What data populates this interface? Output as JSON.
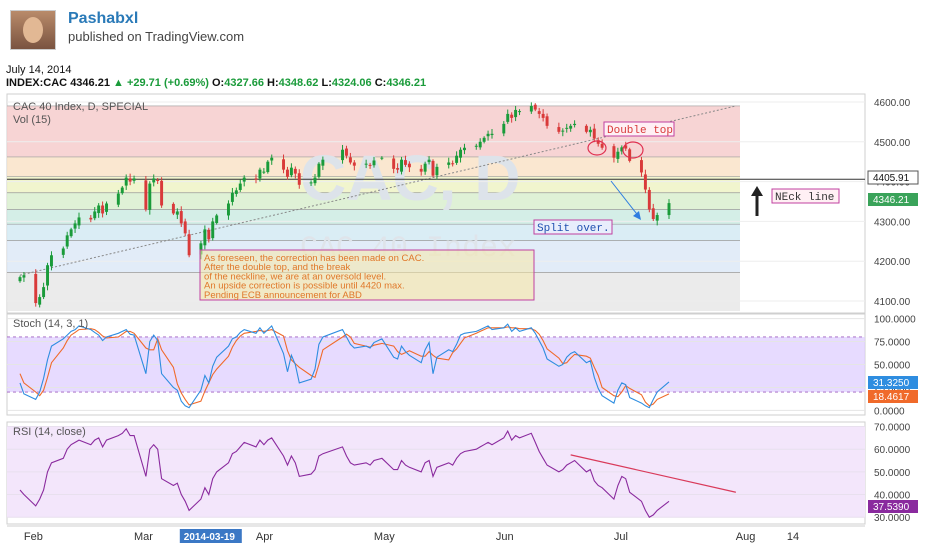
{
  "header": {
    "author": "Pashabxl",
    "published": "published on TradingView.com"
  },
  "date": "July 14, 2014",
  "ohlc": {
    "symbol": "INDEX:CAC",
    "last": "4346.21",
    "change": "+29.71 (+0.69%)",
    "o_label": "O:",
    "o": "4327.66",
    "h_label": "H:",
    "h": "4348.62",
    "l_label": "L:",
    "l": "4324.06",
    "c_label": "C:",
    "c": "4346.21"
  },
  "main_pane": {
    "title": "CAC 40 Index, D, SPECIAL",
    "vol_label": "Vol (15)",
    "watermark": "CAC, D",
    "watermark_sub": "CAC 40 Index",
    "neckline_level": "4405.91",
    "last_price": "4346.21",
    "annotations": {
      "double_top": "Double top",
      "neck_line": "NEck line",
      "split_over": "Split over.",
      "comment": [
        "As foreseen, the correction has been made on CAC.",
        "After the double top, and the break",
        "of the neckline, we are at an oversold level.",
        "An upside correction is possible until 4420 max.",
        "Pending ECB announcement for ABD"
      ]
    }
  },
  "stoch_pane": {
    "title": "Stoch (14, 3, 1)",
    "k_value": "31.3250",
    "d_value": "18.4617"
  },
  "rsi_pane": {
    "title": "RSI (14, close)",
    "value": "37.5390"
  },
  "x_axis": {
    "labels": [
      "Feb",
      "Mar",
      "2014-03-19",
      "Apr",
      "May",
      "Jun",
      "Jul",
      "Aug",
      "14"
    ]
  },
  "colors": {
    "up": "#1a9b3a",
    "down": "#d93a3a",
    "stoch_k": "#2e8de0",
    "stoch_d": "#f06a2a",
    "rsi": "#8a2a9e",
    "trendline": "#d93a5a"
  },
  "chart_data": [
    {
      "type": "candlestick",
      "title": "CAC 40 Index, D, SPECIAL",
      "y_ticks": [
        "4600.00",
        "4500.00",
        "4400.00",
        "4300.00",
        "4200.00",
        "4100.00"
      ],
      "ylim": [
        4070,
        4620
      ],
      "fib_levels": [
        4590,
        4462,
        4413,
        4372,
        4330,
        4293,
        4252,
        4172
      ],
      "x": [
        "2014-01-30",
        "2014-01-31",
        "2014-02-03",
        "2014-02-04",
        "2014-02-05",
        "2014-02-06",
        "2014-02-07",
        "2014-02-10",
        "2014-02-11",
        "2014-02-12",
        "2014-02-13",
        "2014-02-14",
        "2014-02-17",
        "2014-02-18",
        "2014-02-19",
        "2014-02-20",
        "2014-02-21",
        "2014-02-24",
        "2014-02-25",
        "2014-02-26",
        "2014-02-27",
        "2014-02-28",
        "2014-03-03",
        "2014-03-04",
        "2014-03-05",
        "2014-03-06",
        "2014-03-07",
        "2014-03-10",
        "2014-03-11",
        "2014-03-12",
        "2014-03-13",
        "2014-03-14",
        "2014-03-17",
        "2014-03-18",
        "2014-03-19",
        "2014-03-20",
        "2014-03-21",
        "2014-03-24",
        "2014-03-25",
        "2014-03-26",
        "2014-03-27",
        "2014-03-28",
        "2014-03-31",
        "2014-04-01",
        "2014-04-02",
        "2014-04-03",
        "2014-04-04",
        "2014-04-07",
        "2014-04-08",
        "2014-04-09",
        "2014-04-10",
        "2014-04-11",
        "2014-04-14",
        "2014-04-15",
        "2014-04-16",
        "2014-04-17",
        "2014-04-22",
        "2014-04-23",
        "2014-04-24",
        "2014-04-25",
        "2014-04-28",
        "2014-04-29",
        "2014-04-30",
        "2014-05-02",
        "2014-05-05",
        "2014-05-06",
        "2014-05-07",
        "2014-05-08",
        "2014-05-09",
        "2014-05-12",
        "2014-05-13",
        "2014-05-14",
        "2014-05-15",
        "2014-05-16",
        "2014-05-19",
        "2014-05-20",
        "2014-05-21",
        "2014-05-22",
        "2014-05-23",
        "2014-05-26",
        "2014-05-27",
        "2014-05-28",
        "2014-05-29",
        "2014-05-30",
        "2014-06-02",
        "2014-06-03",
        "2014-06-04",
        "2014-06-05",
        "2014-06-06",
        "2014-06-09",
        "2014-06-10",
        "2014-06-11",
        "2014-06-12",
        "2014-06-13",
        "2014-06-16",
        "2014-06-17",
        "2014-06-18",
        "2014-06-19",
        "2014-06-20",
        "2014-06-23",
        "2014-06-24",
        "2014-06-25",
        "2014-06-26",
        "2014-06-27",
        "2014-06-30",
        "2014-07-01",
        "2014-07-02",
        "2014-07-03",
        "2014-07-04",
        "2014-07-07",
        "2014-07-08",
        "2014-07-09",
        "2014-07-10",
        "2014-07-11",
        "2014-07-14"
      ],
      "close": [
        4160,
        4165,
        4095,
        4110,
        4135,
        4190,
        4215,
        4232,
        4265,
        4280,
        4295,
        4310,
        4305,
        4325,
        4340,
        4320,
        4345,
        4370,
        4385,
        4410,
        4400,
        4408,
        4330,
        4395,
        4408,
        4402,
        4340,
        4320,
        4325,
        4295,
        4270,
        4215,
        4245,
        4280,
        4255,
        4300,
        4315,
        4345,
        4372,
        4378,
        4395,
        4410,
        4406,
        4430,
        4425,
        4450,
        4460,
        4430,
        4412,
        4435,
        4420,
        4392,
        4398,
        4410,
        4445,
        4455,
        4480,
        4465,
        4448,
        4440,
        4445,
        4440,
        4453,
        4460,
        4432,
        4430,
        4455,
        4442,
        4436,
        4425,
        4445,
        4455,
        4415,
        4437,
        4448,
        4445,
        4465,
        4480,
        4485,
        4490,
        4500,
        4510,
        4520,
        4520,
        4545,
        4570,
        4560,
        4580,
        4577,
        4590,
        4581,
        4570,
        4560,
        4540,
        4525,
        4528,
        4535,
        4540,
        4545,
        4525,
        4530,
        4508,
        4495,
        4485,
        4460,
        4475,
        4486,
        4483,
        4452,
        4423,
        4380,
        4330,
        4306,
        4316,
        4346
      ],
      "trendlines": [
        {
          "from": [
            "2014-01-30",
            4165
          ],
          "to": [
            "2014-07-31",
            4590
          ]
        },
        {
          "from": [
            "2014-06-20",
            4410
          ],
          "to": [
            "2014-07-31",
            4410
          ]
        }
      ]
    },
    {
      "type": "line",
      "title": "Stoch (14, 3, 1)",
      "y_ticks": [
        "100.0000",
        "75.0000",
        "50.0000",
        "25.0000",
        "0.0000"
      ],
      "ylim": [
        -5,
        105
      ],
      "bands": [
        20,
        80
      ],
      "series": [
        {
          "name": "K",
          "values": [
            30,
            18,
            12,
            20,
            35,
            55,
            70,
            78,
            82,
            86,
            88,
            92,
            88,
            85,
            82,
            76,
            80,
            84,
            86,
            88,
            83,
            82,
            40,
            75,
            82,
            76,
            40,
            25,
            22,
            10,
            5,
            3,
            22,
            38,
            30,
            48,
            58,
            70,
            78,
            80,
            85,
            88,
            84,
            90,
            84,
            88,
            92,
            62,
            42,
            60,
            50,
            30,
            34,
            45,
            72,
            80,
            88,
            80,
            72,
            68,
            70,
            68,
            74,
            78,
            58,
            56,
            70,
            64,
            60,
            52,
            66,
            74,
            40,
            58,
            66,
            64,
            72,
            82,
            84,
            86,
            88,
            90,
            92,
            88,
            90,
            94,
            86,
            90,
            86,
            90,
            84,
            76,
            68,
            56,
            48,
            50,
            58,
            62,
            64,
            52,
            54,
            36,
            24,
            16,
            8,
            22,
            30,
            28,
            14,
            8,
            5,
            3,
            12,
            20,
            31
          ]
        },
        {
          "name": "D",
          "values": [
            40,
            30,
            20,
            16,
            22,
            36,
            52,
            68,
            76,
            82,
            85,
            88,
            89,
            88,
            85,
            81,
            79,
            80,
            83,
            86,
            86,
            84,
            68,
            66,
            66,
            78,
            66,
            47,
            29,
            19,
            12,
            6,
            10,
            21,
            30,
            39,
            45,
            59,
            69,
            76,
            81,
            84,
            86,
            87,
            86,
            87,
            88,
            81,
            65,
            55,
            51,
            47,
            38,
            36,
            50,
            66,
            80,
            83,
            80,
            73,
            70,
            69,
            71,
            73,
            70,
            64,
            61,
            63,
            65,
            59,
            59,
            64,
            60,
            57,
            55,
            63,
            67,
            73,
            79,
            84,
            86,
            88,
            90,
            90,
            90,
            91,
            90,
            90,
            89,
            89,
            87,
            83,
            76,
            67,
            57,
            51,
            52,
            57,
            61,
            59,
            57,
            47,
            38,
            25,
            16,
            15,
            20,
            27,
            24,
            17,
            9,
            5,
            7,
            12,
            18
          ]
        }
      ]
    },
    {
      "type": "line",
      "title": "RSI (14, close)",
      "y_ticks": [
        "70.0000",
        "60.0000",
        "50.0000",
        "40.0000",
        "30.0000"
      ],
      "ylim": [
        27,
        72
      ],
      "bands": [
        30,
        70
      ],
      "series": [
        {
          "name": "RSI",
          "values": [
            42,
            40,
            35,
            38,
            42,
            50,
            54,
            56,
            60,
            62,
            63,
            64,
            62,
            64,
            65,
            61,
            64,
            66,
            67,
            69,
            66,
            66,
            48,
            60,
            62,
            60,
            47,
            44,
            45,
            40,
            37,
            33,
            38,
            43,
            40,
            47,
            50,
            54,
            58,
            59,
            61,
            63,
            61,
            64,
            62,
            64,
            65,
            57,
            53,
            57,
            54,
            48,
            49,
            51,
            57,
            58,
            61,
            57,
            54,
            53,
            54,
            53,
            55,
            56,
            51,
            51,
            55,
            53,
            52,
            50,
            54,
            55,
            48,
            52,
            54,
            53,
            56,
            58,
            59,
            60,
            61,
            62,
            63,
            62,
            65,
            68,
            64,
            66,
            65,
            67,
            63,
            59,
            56,
            53,
            50,
            51,
            53,
            54,
            55,
            50,
            51,
            46,
            44,
            43,
            38,
            44,
            48,
            47,
            41,
            37,
            33,
            30,
            31,
            33,
            37
          ]
        }
      ],
      "trendline": {
        "from": [
          "2014-06-19",
          57.5
        ],
        "to": [
          "2014-07-31",
          41
        ]
      }
    }
  ]
}
